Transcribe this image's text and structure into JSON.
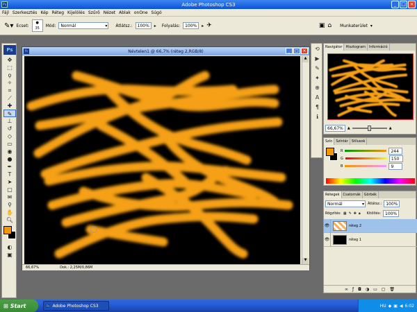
{
  "window": {
    "title": "Adobe Photoshop CS3"
  },
  "menu": [
    "Fájl",
    "Szerkesztés",
    "Kép",
    "Réteg",
    "Kijelölés",
    "Szűrő",
    "Nézet",
    "Ablak",
    "onOne",
    "Súgó"
  ],
  "options": {
    "brush_label": "Ecset:",
    "brush_size": "35",
    "mode_label": "Mód:",
    "mode_value": "Normál",
    "opacity_label": "Átlátsz.:",
    "opacity_value": "100%",
    "flow_label": "Folyalás:",
    "flow_value": "100%",
    "workspace_label": "Munkaterület"
  },
  "document": {
    "title": "Névtelen1 @ 66,7% (réteg 2,RGB/8)",
    "zoom": "66,67%",
    "doc_info": "Dok.: 2,25M/0,86M"
  },
  "navigator": {
    "tabs": [
      "Navigátor",
      "Hisztogram",
      "Információ"
    ],
    "zoom": "66,67%"
  },
  "color": {
    "tabs": [
      "Szín",
      "Színtár",
      "Stílusok"
    ],
    "r_label": "R",
    "r": "244",
    "g_label": "G",
    "g": "150",
    "b_label": "B",
    "b": "9",
    "fg_color": "#f49609"
  },
  "layers": {
    "tabs": [
      "Rétegek",
      "Csatornák",
      "Görbék"
    ],
    "blend": "Normál",
    "opacity_label": "Átlátsz.:",
    "opacity": "100%",
    "lock_label": "Rögzítés:",
    "fill_label": "Kitöltés:",
    "fill": "100%",
    "items": [
      {
        "name": "réteg 2",
        "selected": true
      },
      {
        "name": "réteg 1",
        "selected": false
      }
    ]
  },
  "taskbar": {
    "start": "Start",
    "app": "Adobe Photoshop CS3",
    "lang": "HU",
    "time": "6:02"
  },
  "stroke_color": "#f5a012"
}
